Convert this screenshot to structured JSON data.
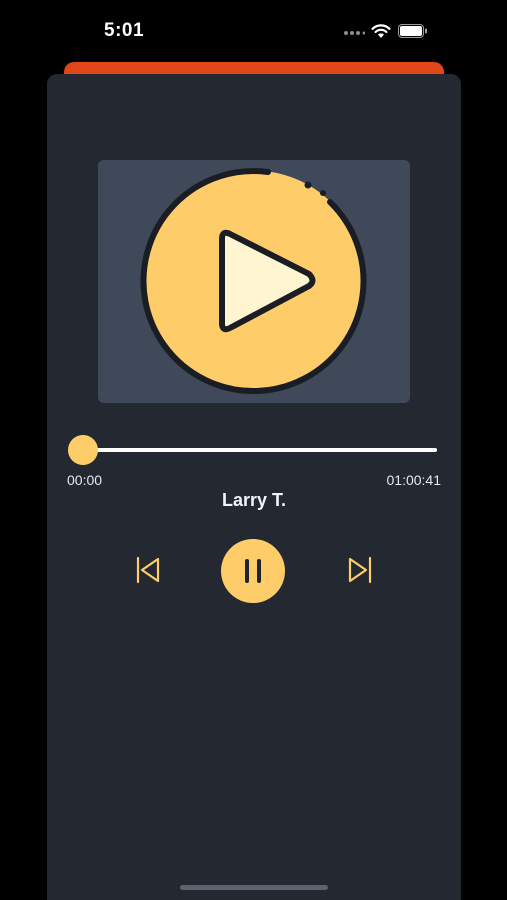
{
  "status_bar": {
    "time": "5:01",
    "icons": [
      "cellular-dots-icon",
      "wifi-icon",
      "battery-icon"
    ]
  },
  "player": {
    "artwork_icon": "play-icon",
    "position_label": "00:00",
    "duration_label": "01:00:41",
    "progress_fraction": 0,
    "track_title": "Larry T.",
    "controls": {
      "previous_icon": "skip-previous-icon",
      "pause_icon": "pause-icon",
      "next_icon": "skip-next-icon"
    }
  },
  "colors": {
    "background": "#000000",
    "card": "#232831",
    "artwork_bg": "#3f4959",
    "accent": "#fecd69",
    "sheet_accent": "#e0461a",
    "text": "#ffffff"
  }
}
